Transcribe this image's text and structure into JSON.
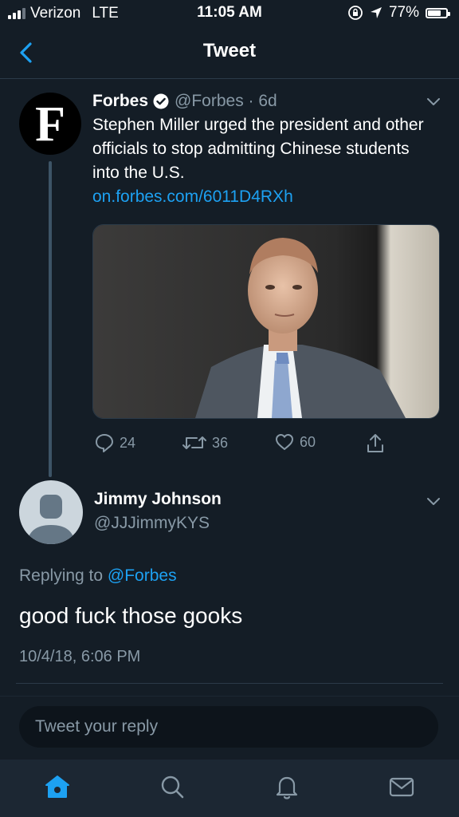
{
  "status_bar": {
    "carrier": "Verizon",
    "network": "LTE",
    "time": "11:05 AM",
    "battery_percent": "77%",
    "battery_level": 0.77
  },
  "nav": {
    "title": "Tweet"
  },
  "tweet": {
    "author_name": "Forbes",
    "avatar_letter": "F",
    "handle_time": "@Forbes · 6d",
    "text": "Stephen Miller urged the president and other officials to stop admitting Chinese students into the U.S.",
    "link": "on.forbes.com/6011D4RXh",
    "replies": "24",
    "retweets": "36",
    "likes": "60"
  },
  "reply": {
    "author_name": "Jimmy Johnson",
    "handle": "@JJJimmyKYS",
    "replying_label": "Replying to",
    "replying_handle": "@Forbes",
    "text": "good fuck those gooks",
    "timestamp": "10/4/18, 6:06 PM"
  },
  "composer": {
    "placeholder": "Tweet your reply"
  },
  "colors": {
    "background": "#141d26",
    "accent": "#1da1f2",
    "muted": "#8899a6",
    "tabbar": "#1c2733"
  },
  "icons": [
    "signal-icon",
    "orientation-lock-icon",
    "location-arrow-icon",
    "battery-icon",
    "back-chevron-icon",
    "verified-badge-icon",
    "chevron-down-icon",
    "reply-icon",
    "retweet-icon",
    "like-icon",
    "share-icon",
    "home-icon",
    "search-icon",
    "notifications-icon",
    "messages-icon"
  ]
}
